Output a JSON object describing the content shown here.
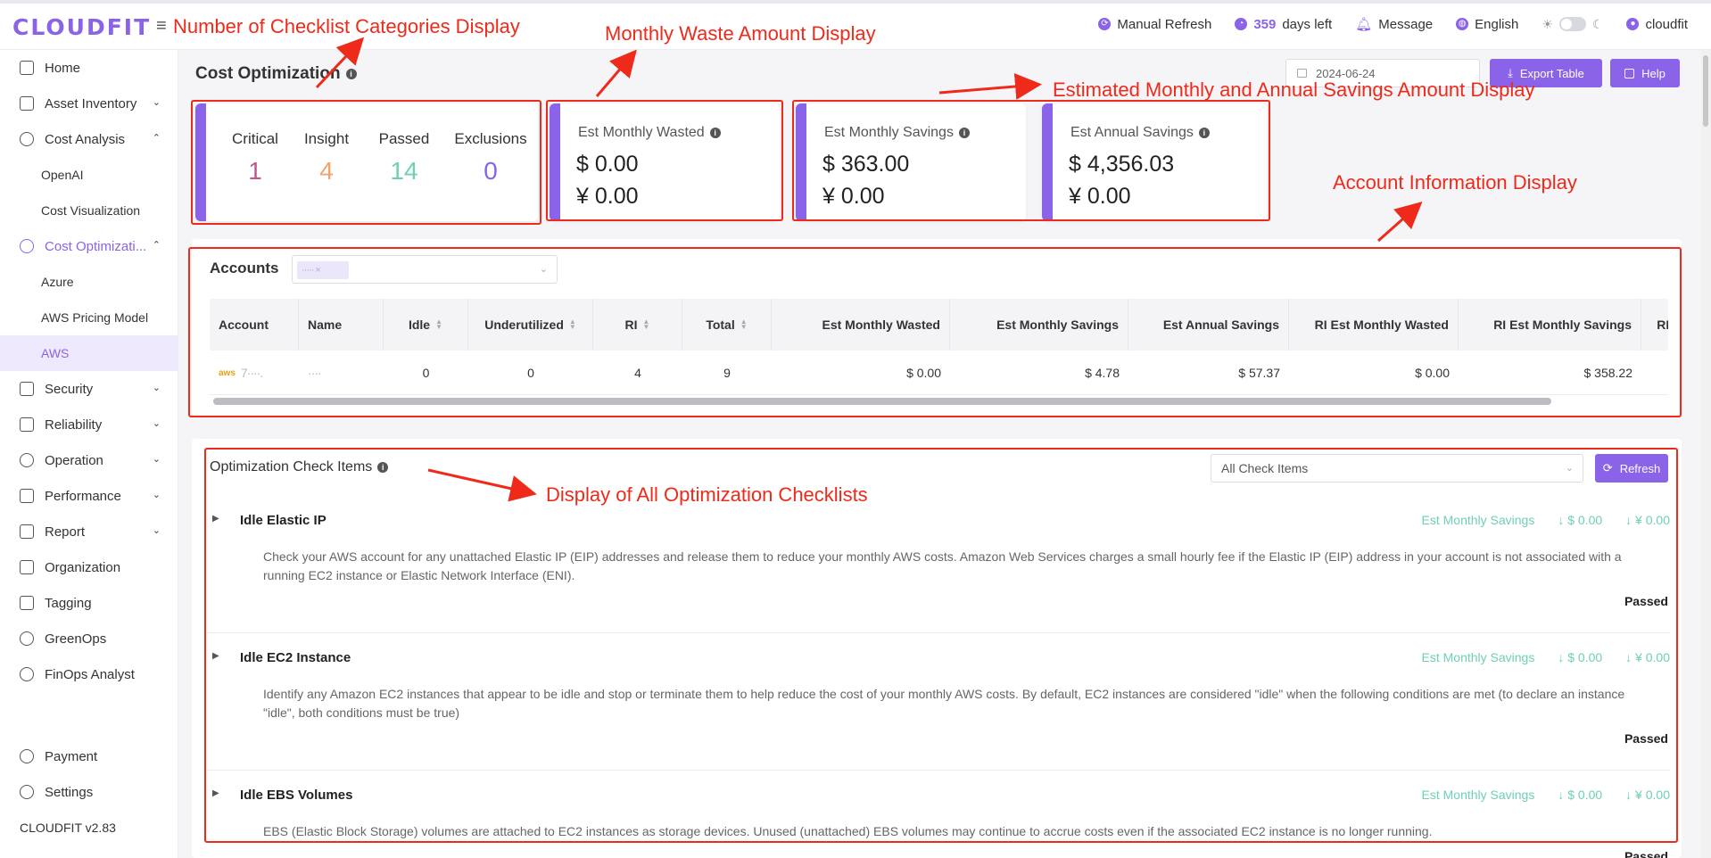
{
  "app": {
    "logo": "CLOUDFIT",
    "version": "CLOUDFIT v2.83"
  },
  "topbar": {
    "manual_refresh": "Manual Refresh",
    "days_left_num": "359",
    "days_left_text": "days left",
    "message": "Message",
    "language": "English",
    "user": "cloudfit"
  },
  "sidebar": {
    "items": [
      {
        "label": "Home"
      },
      {
        "label": "Asset Inventory"
      },
      {
        "label": "Cost Analysis"
      },
      {
        "label": "OpenAI"
      },
      {
        "label": "Cost Visualization"
      },
      {
        "label": "Cost Optimizati..."
      },
      {
        "label": "Azure"
      },
      {
        "label": "AWS Pricing Model"
      },
      {
        "label": "AWS"
      },
      {
        "label": "Security"
      },
      {
        "label": "Reliability"
      },
      {
        "label": "Operation"
      },
      {
        "label": "Performance"
      },
      {
        "label": "Report"
      },
      {
        "label": "Organization"
      },
      {
        "label": "Tagging"
      },
      {
        "label": "GreenOps"
      },
      {
        "label": "FinOps Analyst"
      },
      {
        "label": "Payment"
      },
      {
        "label": "Settings"
      }
    ]
  },
  "header": {
    "title": "Cost Optimization",
    "date": "2024-06-24",
    "export_label": "Export Table",
    "help_label": "Help"
  },
  "status_summary": {
    "critical_label": "Critical",
    "critical_value": "1",
    "insight_label": "Insight",
    "insight_value": "4",
    "passed_label": "Passed",
    "passed_value": "14",
    "exclusions_label": "Exclusions",
    "exclusions_value": "0",
    "critical_color": "#c0568b",
    "insight_color": "#f0a46a",
    "passed_color": "#6fcfb6",
    "exclusions_color": "#8a63e9"
  },
  "cards": {
    "wasted": {
      "label": "Est Monthly Wasted",
      "usd": "$  0.00",
      "cny": "¥  0.00"
    },
    "monthly_savings": {
      "label": "Est Monthly Savings",
      "usd": "$  363.00",
      "cny": "¥  0.00"
    },
    "annual_savings": {
      "label": "Est Annual Savings",
      "usd": "$  4,356.03",
      "cny": "¥  0.00"
    }
  },
  "accounts": {
    "title": "Accounts",
    "tag": "·····  ×",
    "columns": [
      "Account",
      "Name",
      "Idle",
      "Underutilized",
      "RI",
      "Total",
      "Est Monthly Wasted",
      "Est Monthly Savings",
      "Est Annual Savings",
      "RI Est Monthly Wasted",
      "RI Est Monthly Savings",
      "RI I"
    ],
    "row": {
      "aws_logo": "aws",
      "account": "7····.",
      "name": "····",
      "idle": "0",
      "underutilized": "0",
      "ri": "4",
      "total": "9",
      "wasted": "$ 0.00",
      "monthly_savings": "$ 4.78",
      "annual_savings": "$ 57.37",
      "ri_wasted": "$ 0.00",
      "ri_monthly_savings": "$ 358.22"
    }
  },
  "checks": {
    "title": "Optimization Check Items",
    "filter": "All Check Items",
    "refresh_label": "Refresh",
    "savings_label": "Est Monthly Savings",
    "items": [
      {
        "name": "Idle Elastic IP",
        "usd": "↓ $  0.00",
        "cny": "↓ ¥  0.00",
        "desc": "Check your AWS account for any unattached Elastic IP (EIP) addresses and release them to reduce your monthly AWS costs. Amazon Web Services charges a small hourly fee if the Elastic IP (EIP) address in your account is not associated with a running EC2 instance or Elastic Network Interface (ENI).",
        "status": "Passed"
      },
      {
        "name": "Idle EC2 Instance",
        "usd": "↓ $  0.00",
        "cny": "↓ ¥  0.00",
        "desc": "Identify any Amazon EC2 instances that appear to be idle and stop or terminate them to help reduce the cost of your monthly AWS costs. By default, EC2 instances are considered \"idle\" when the following conditions are met (to declare an instance \"idle\", both conditions must be true)",
        "status": "Passed"
      },
      {
        "name": "Idle EBS Volumes",
        "usd": "↓ $  0.00",
        "cny": "↓ ¥  0.00",
        "desc": "EBS (Elastic Block Storage) volumes are attached to EC2 instances as storage devices. Unused (unattached) EBS volumes may continue to accrue costs even if the associated EC2 instance is no longer running.",
        "status": "Passed"
      }
    ]
  },
  "annotations": {
    "categories": "Number of Checklist Categories Display",
    "waste": "Monthly Waste Amount Display",
    "savings": "Estimated Monthly and Annual Savings Amount Display",
    "account": "Account Information Display",
    "checklists": "Display of All Optimization Checklists"
  },
  "colors": {
    "accent": "#8a63e9",
    "annotation": "#ee2a1b",
    "savings_green": "#6fcfb6"
  }
}
